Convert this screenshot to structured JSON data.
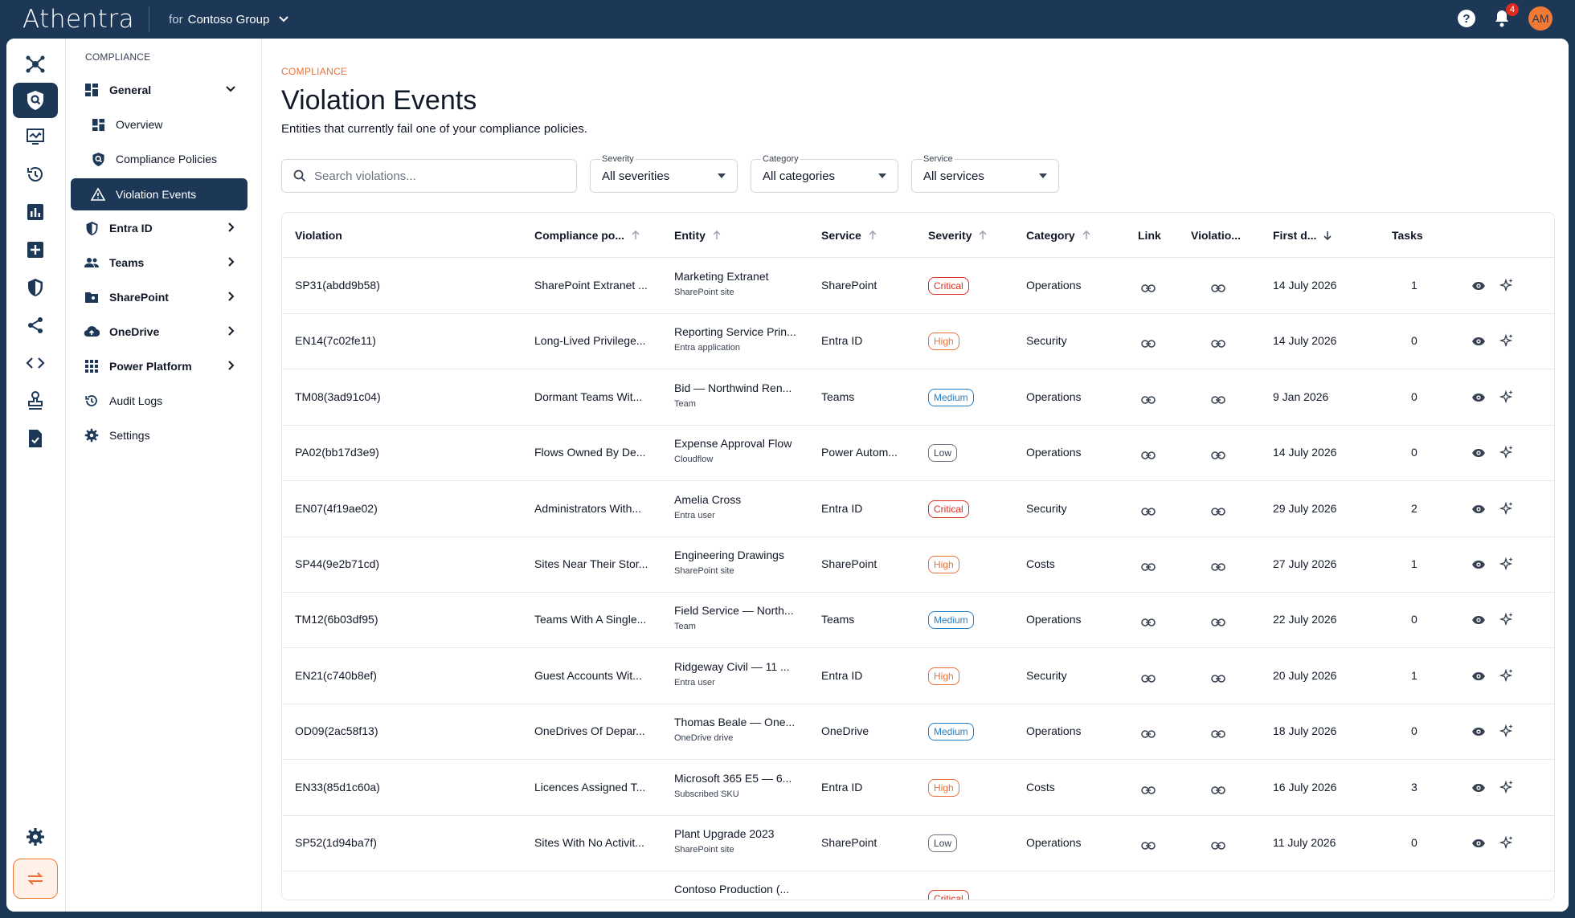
{
  "header": {
    "brand": "Athentra",
    "org_prefix": "for",
    "org_name": "Contoso Group",
    "notification_count": "4",
    "avatar_initials": "AM",
    "help_glyph": "?"
  },
  "rail": {
    "icons": [
      "hub-icon",
      "shield-search-icon",
      "monitor-icon",
      "history-icon",
      "bar-chart-icon",
      "plus-box-icon",
      "security-shield-icon",
      "share-icon",
      "code-icon",
      "stamp-icon",
      "checklist-icon"
    ],
    "settings_icon": "gear-icon",
    "switch_icon": "swap-icon"
  },
  "sidebar": {
    "section_label": "COMPLIANCE",
    "items": [
      {
        "label": "General",
        "icon": "dashboard-icon",
        "kind": "group",
        "chevron": "down"
      },
      {
        "label": "Overview",
        "icon": "dashboard-icon",
        "kind": "sub"
      },
      {
        "label": "Compliance Policies",
        "icon": "shield-search-icon",
        "kind": "sub"
      },
      {
        "label": "Violation Events",
        "icon": "warning-icon",
        "kind": "sub",
        "active": true
      },
      {
        "label": "Entra ID",
        "icon": "shield-icon",
        "kind": "group",
        "chevron": "right"
      },
      {
        "label": "Teams",
        "icon": "people-icon",
        "kind": "group",
        "chevron": "right"
      },
      {
        "label": "SharePoint",
        "icon": "folder-icon",
        "kind": "group",
        "chevron": "right"
      },
      {
        "label": "OneDrive",
        "icon": "cloud-upload-icon",
        "kind": "group",
        "chevron": "right"
      },
      {
        "label": "Power Platform",
        "icon": "grid-icon",
        "kind": "group",
        "chevron": "right"
      },
      {
        "label": "Audit Logs",
        "icon": "history-icon",
        "kind": "plain"
      },
      {
        "label": "Settings",
        "icon": "gear-icon",
        "kind": "plain"
      }
    ]
  },
  "main": {
    "breadcrumb": "COMPLIANCE",
    "title": "Violation Events",
    "subtitle": "Entities that currently fail one of your compliance policies.",
    "search_placeholder": "Search violations...",
    "filters": [
      {
        "label": "Severity",
        "value": "All severities"
      },
      {
        "label": "Category",
        "value": "All categories"
      },
      {
        "label": "Service",
        "value": "All services"
      }
    ]
  },
  "table": {
    "columns": [
      "Violation",
      "Compliance po...",
      "Entity",
      "Service",
      "Severity",
      "Category",
      "Link",
      "Violatio...",
      "First d...",
      "Tasks"
    ],
    "rows": [
      {
        "violation": "SP31(abdd9b58)",
        "policy": "SharePoint Extranet ...",
        "entity": "Marketing Extranet",
        "entity_type": "SharePoint site",
        "service": "SharePoint",
        "severity": "Critical",
        "category": "Operations",
        "first": "14 July 2026",
        "tasks": "1"
      },
      {
        "violation": "EN14(7c02fe11)",
        "policy": "Long-Lived Privilege...",
        "entity": "Reporting Service Prin...",
        "entity_type": "Entra application",
        "service": "Entra ID",
        "severity": "High",
        "category": "Security",
        "first": "14 July 2026",
        "tasks": "0"
      },
      {
        "violation": "TM08(3ad91c04)",
        "policy": "Dormant Teams Wit...",
        "entity": "Bid — Northwind Ren...",
        "entity_type": "Team",
        "service": "Teams",
        "severity": "Medium",
        "category": "Operations",
        "first": "9 Jan 2026",
        "tasks": "0"
      },
      {
        "violation": "PA02(bb17d3e9)",
        "policy": "Flows Owned By De...",
        "entity": "Expense Approval Flow",
        "entity_type": "Cloudflow",
        "service": "Power Autom...",
        "severity": "Low",
        "category": "Operations",
        "first": "14 July 2026",
        "tasks": "0"
      },
      {
        "violation": "EN07(4f19ae02)",
        "policy": "Administrators With...",
        "entity": "Amelia Cross",
        "entity_type": "Entra user",
        "service": "Entra ID",
        "severity": "Critical",
        "category": "Security",
        "first": "29 July 2026",
        "tasks": "2"
      },
      {
        "violation": "SP44(9e2b71cd)",
        "policy": "Sites Near Their Stor...",
        "entity": "Engineering Drawings",
        "entity_type": "SharePoint site",
        "service": "SharePoint",
        "severity": "High",
        "category": "Costs",
        "first": "27 July 2026",
        "tasks": "1"
      },
      {
        "violation": "TM12(6b03df95)",
        "policy": "Teams With A Single...",
        "entity": "Field Service — North...",
        "entity_type": "Team",
        "service": "Teams",
        "severity": "Medium",
        "category": "Operations",
        "first": "22 July 2026",
        "tasks": "0"
      },
      {
        "violation": "EN21(c740b8ef)",
        "policy": "Guest Accounts Wit...",
        "entity": "Ridgeway Civil — 11 ...",
        "entity_type": "Entra user",
        "service": "Entra ID",
        "severity": "High",
        "category": "Security",
        "first": "20 July 2026",
        "tasks": "1"
      },
      {
        "violation": "OD09(2ac58f13)",
        "policy": "OneDrives Of Depar...",
        "entity": "Thomas Beale — One...",
        "entity_type": "OneDrive drive",
        "service": "OneDrive",
        "severity": "Medium",
        "category": "Operations",
        "first": "18 July 2026",
        "tasks": "0"
      },
      {
        "violation": "EN33(85d1c60a)",
        "policy": "Licences Assigned T...",
        "entity": "Microsoft 365 E5 — 6...",
        "entity_type": "Subscribed SKU",
        "service": "Entra ID",
        "severity": "High",
        "category": "Costs",
        "first": "16 July 2026",
        "tasks": "3"
      },
      {
        "violation": "SP52(1d94ba7f)",
        "policy": "Sites With No Activit...",
        "entity": "Plant Upgrade 2023",
        "entity_type": "SharePoint site",
        "service": "SharePoint",
        "severity": "Low",
        "category": "Operations",
        "first": "11 July 2026",
        "tasks": "0"
      },
      {
        "violation": "",
        "policy": "",
        "entity": "Contoso Production (...",
        "entity_type": "",
        "service": "",
        "severity": "Critical",
        "category": "",
        "first": "",
        "tasks": ""
      }
    ]
  },
  "colors": {
    "navy": "#1d3757",
    "accent_orange": "#e8713a",
    "critical": "#d92d20",
    "high": "#e8713a",
    "medium": "#1e7fc9",
    "low": "#6b7280"
  }
}
